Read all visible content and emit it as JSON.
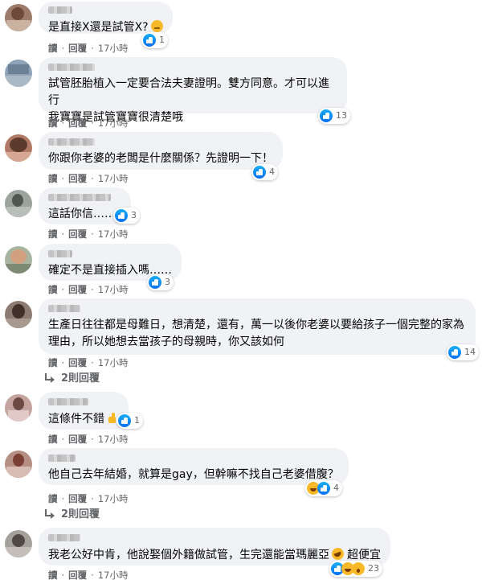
{
  "labels": {
    "read": "讀",
    "reply": "回覆",
    "dot": "·"
  },
  "comments": [
    {
      "text": "是直接X還是試管X?",
      "emoji": "thinking-face",
      "reactions": {
        "count": "1",
        "types": [
          "like"
        ]
      },
      "time": "17小時"
    },
    {
      "text": "試管胚胎植入一定要合法夫妻證明。雙方同意。才可以進行\n我寶寶是試管寶寶很清楚哦",
      "reactions": {
        "count": "13",
        "types": [
          "like"
        ]
      },
      "time": "17小時"
    },
    {
      "text": "你跟你老婆的老闆是什麼關係？先證明一下！",
      "reactions": {
        "count": "4",
        "types": [
          "like"
        ]
      },
      "time": "17小時"
    },
    {
      "text": "這話你信……?",
      "reactions": {
        "count": "3",
        "types": [
          "like"
        ]
      },
      "time": "17小時"
    },
    {
      "text": "確定不是直接插入嗎……",
      "reactions": {
        "count": "3",
        "types": [
          "like"
        ]
      },
      "time": "17小時"
    },
    {
      "text": "生產日往往都是母難日，想清楚，還有，萬一以後你老婆以要給孩子一個完整的家為\n理由，所以她想去當孩子的母親時，你又該如何",
      "reactions": {
        "count": "14",
        "types": [
          "like"
        ]
      },
      "time": "17小時",
      "replies_label": "2則回覆"
    },
    {
      "text": "這條件不錯",
      "emoji": "thumbs-up",
      "reactions": {
        "count": "1",
        "types": [
          "like"
        ]
      },
      "time": "17小時"
    },
    {
      "text": "他自己去年結婚，就算是gay，但幹嘛不找自己老婆借腹？",
      "reactions": {
        "count": "4",
        "types": [
          "haha",
          "like"
        ]
      },
      "time": "17小時",
      "replies_label": "2則回覆"
    },
    {
      "text": "我老公好中肯，他說娶個外籍做試管，生完還能當瑪麗亞",
      "emoji": "rofl-face",
      "text_tail": "超便宜",
      "reactions": {
        "count": "23",
        "types": [
          "like",
          "haha",
          "wow"
        ]
      },
      "time": "17小時"
    }
  ]
}
